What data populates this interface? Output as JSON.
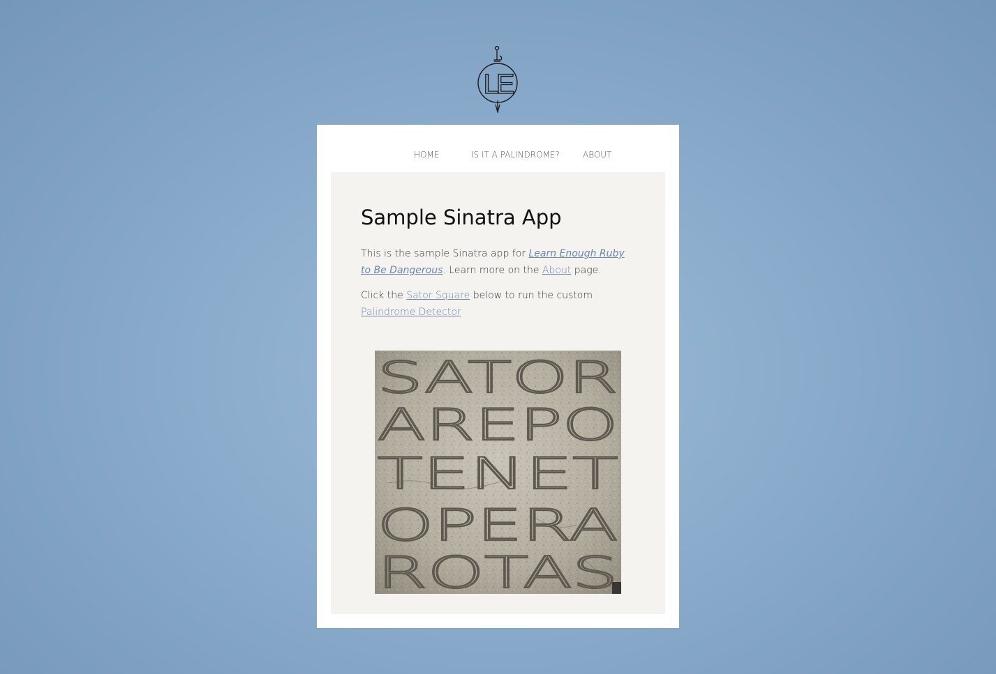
{
  "logo": {
    "text": "LE",
    "icon": "learn-enough-sword-logo"
  },
  "nav": {
    "home": "HOME",
    "palindrome": "IS IT A PALINDROME?",
    "about": "ABOUT"
  },
  "main": {
    "title": "Sample Sinatra App",
    "p1_prefix": "This is the sample Sinatra app for ",
    "p1_link": "Learn Enough Ruby to Be Dangerous",
    "p1_middle": ". Learn more on the ",
    "p1_about_link": "About",
    "p1_suffix": " page.",
    "p2_prefix": "Click the ",
    "p2_sator_link": "Sator Square",
    "p2_middle": " below to run the custom ",
    "p2_detector_link": "Palindrome Detector"
  },
  "sator_square": {
    "rows": [
      "SATOR",
      "AREPO",
      "TENET",
      "OPERA",
      "ROTAS"
    ]
  },
  "colors": {
    "background": "#8aabcb",
    "card": "#ffffff",
    "content_panel": "#f4f3f0",
    "link": "#6d86a8"
  }
}
